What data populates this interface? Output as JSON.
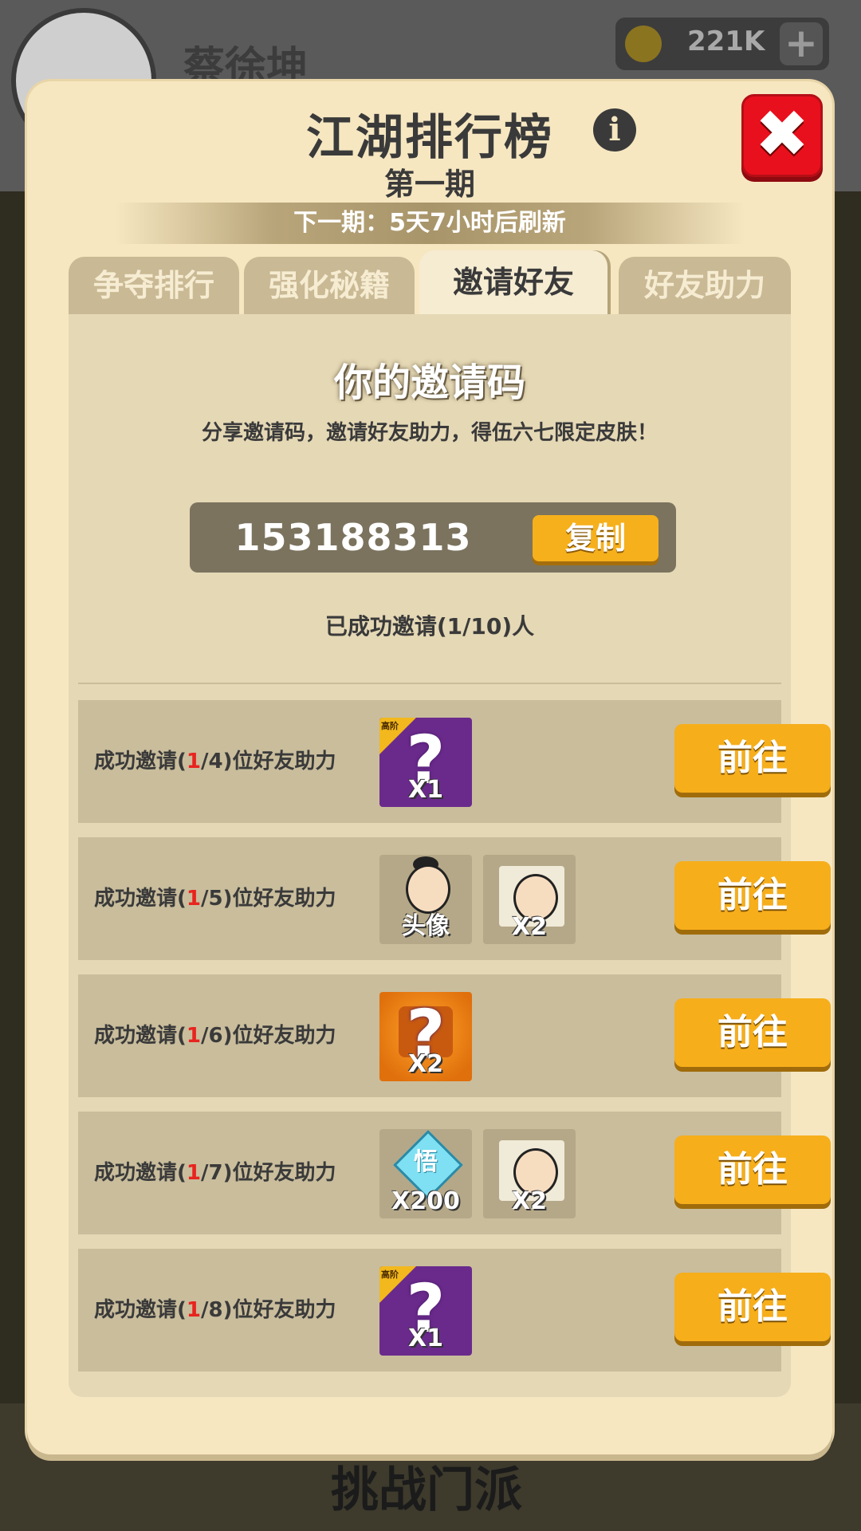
{
  "background": {
    "player_name": "蔡徐坤",
    "coins": "221K",
    "bottom_title": "挑战门派"
  },
  "panel": {
    "title": "江湖排行榜",
    "subtitle": "第一期",
    "refresh_text": "下一期：5天7小时后刷新",
    "tabs": [
      {
        "label": "争夺排行",
        "active": false
      },
      {
        "label": "强化秘籍",
        "active": false
      },
      {
        "label": "邀请好友",
        "active": true
      },
      {
        "label": "好友助力",
        "active": false
      }
    ],
    "invite": {
      "heading": "你的邀请码",
      "description": "分享邀请码，邀请好友助力，得伍六七限定皮肤！",
      "code": "153188313",
      "copy_label": "复制",
      "count_text": "已成功邀请(1/10)人"
    },
    "rewards": [
      {
        "prefix": "成功邀请(",
        "progress": "1",
        "suffix": "/4)位好友助力",
        "items": [
          {
            "icon": "mystery-box-icon",
            "badge": "高阶",
            "qty": "X1"
          }
        ],
        "button": "前往"
      },
      {
        "prefix": "成功邀请(",
        "progress": "1",
        "suffix": "/5)位好友助力",
        "items": [
          {
            "icon": "avatar-portrait-icon",
            "qty": "头像"
          },
          {
            "icon": "character-fragment-icon",
            "qty": "X2"
          }
        ],
        "button": "前往"
      },
      {
        "prefix": "成功邀请(",
        "progress": "1",
        "suffix": "/6)位好友助力",
        "items": [
          {
            "icon": "mystery-outfit-icon",
            "qty": "X2"
          }
        ],
        "button": "前往"
      },
      {
        "prefix": "成功邀请(",
        "progress": "1",
        "suffix": "/7)位好友助力",
        "items": [
          {
            "icon": "wu-gem-icon",
            "gem_char": "悟",
            "qty": "X200"
          },
          {
            "icon": "character-fragment-icon",
            "qty": "X2"
          }
        ],
        "button": "前往"
      },
      {
        "prefix": "成功邀请(",
        "progress": "1",
        "suffix": "/8)位好友助力",
        "items": [
          {
            "icon": "mystery-box-icon",
            "badge": "高阶",
            "qty": "X1"
          }
        ],
        "button": "前往"
      }
    ]
  },
  "colors": {
    "panel_bg": "#f6e7c1",
    "accent_button": "#f6ae1b",
    "close_red": "#e8101c",
    "progress_red": "#e8241e"
  }
}
